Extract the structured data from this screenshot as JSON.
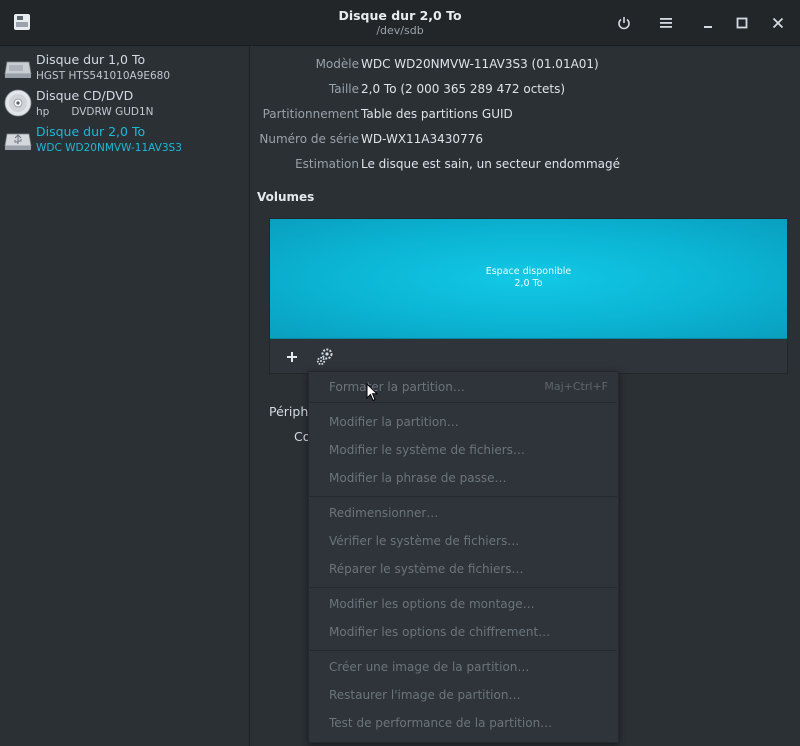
{
  "window": {
    "title": "Disque dur 2,0 To",
    "subtitle": "/dev/sdb"
  },
  "sidebar": {
    "items": [
      {
        "name": "Disque dur 1,0 To",
        "sub_left": "HGST HTS541010A9E680",
        "sub_right": "",
        "icon": "hard-disk-icon"
      },
      {
        "name": "Disque CD/DVD",
        "sub_left": "hp",
        "sub_right": "DVDRW GUD1N",
        "icon": "optical-disc-icon"
      },
      {
        "name": "Disque dur 2,0 To",
        "sub_left": "WDC WD20NMVW-11AV3S3",
        "sub_right": "",
        "icon": "usb-disk-icon"
      }
    ]
  },
  "properties": [
    {
      "label": "Modèle",
      "value": "WDC WD20NMVW-11AV3S3 (01.01A01)"
    },
    {
      "label": "Taille",
      "value": "2,0 To (2 000 365 289 472 octets)"
    },
    {
      "label": "Partitionnement",
      "value": "Table des partitions GUID"
    },
    {
      "label": "Numéro de série",
      "value": "WD-WX11A3430776"
    },
    {
      "label": "Estimation",
      "value": "Le disque est sain, un secteur endommagé"
    }
  ],
  "volumes": {
    "heading": "Volumes",
    "bar_label": "Espace disponible",
    "bar_size": "2,0 To",
    "partial_label_1": "Périphé",
    "partial_label_2": "Co"
  },
  "menu": {
    "items": [
      {
        "label": "Formater la partition…",
        "shortcut": "Maj+Ctrl+F"
      },
      {
        "label": "Modifier la partition…"
      },
      {
        "label": "Modifier le système de fichiers…"
      },
      {
        "label": "Modifier la phrase de passe…"
      },
      {
        "label": "Redimensionner…"
      },
      {
        "label": "Vérifier le système de fichiers…"
      },
      {
        "label": "Réparer le système de fichiers…"
      },
      {
        "label": "Modifier les options de montage…"
      },
      {
        "label": "Modifier les options de chiffrement…"
      },
      {
        "label": "Créer une image de la partition…"
      },
      {
        "label": "Restaurer l'image de partition…"
      },
      {
        "label": "Test de performance de la partition…"
      }
    ]
  },
  "colors": {
    "accent": "#1fb8d6",
    "volume_fill": "#0bb4d3",
    "background": "#2b3035"
  }
}
